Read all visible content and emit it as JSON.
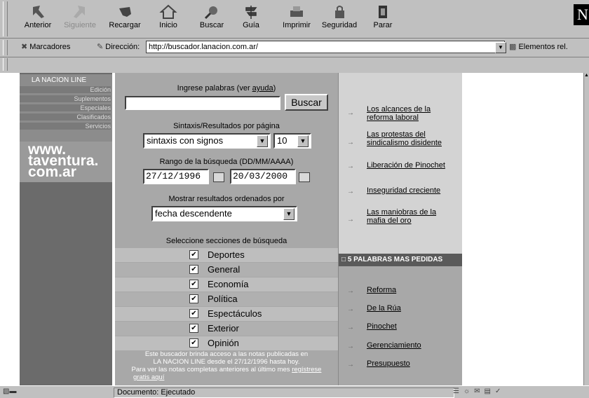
{
  "toolbar": {
    "buttons": [
      {
        "label": "Anterior",
        "icon": "back-arrow-icon",
        "enabled": true
      },
      {
        "label": "Siguiente",
        "icon": "forward-arrow-icon",
        "enabled": false
      },
      {
        "label": "Recargar",
        "icon": "reload-icon",
        "enabled": true
      },
      {
        "label": "Inicio",
        "icon": "home-icon",
        "enabled": true
      },
      {
        "label": "Buscar",
        "icon": "search-icon",
        "enabled": true
      },
      {
        "label": "Guía",
        "icon": "guide-icon",
        "enabled": true
      },
      {
        "label": "Imprimir",
        "icon": "print-icon",
        "enabled": true
      },
      {
        "label": "Seguridad",
        "icon": "lock-icon",
        "enabled": true
      },
      {
        "label": "Parar",
        "icon": "stop-icon",
        "enabled": true
      }
    ],
    "logo": "N"
  },
  "addressbar": {
    "bookmarks_label": "Marcadores",
    "address_label": "Dirección:",
    "url": "http://buscador.lanacion.com.ar/",
    "related_label": "Elementos rel."
  },
  "sidebar": {
    "title": "LA NACION LINE",
    "items": [
      "Edición",
      "Suplementos",
      "Especiales",
      "Clasificados",
      "Servicios"
    ],
    "promo_lines": [
      "www.",
      "taventura.",
      "com.ar"
    ]
  },
  "search": {
    "prompt": "Ingrese palabras (ver ",
    "help_link": "ayuda",
    "prompt_end": ")",
    "query": "",
    "button": "Buscar",
    "syntax_label": "Sintaxis/Resultados por página",
    "syntax_value": "sintaxis con signos",
    "per_page_value": "10",
    "range_label": "Rango de la búsqueda (DD/MM/AAAA)",
    "date_from": "27/12/1996",
    "date_to": "20/03/2000",
    "order_label": "Mostrar resultados ordenados por",
    "order_value": "fecha descendente",
    "sections_label": "Seleccione secciones de búsqueda",
    "sections": [
      {
        "label": "Deportes",
        "checked": true
      },
      {
        "label": "General",
        "checked": true
      },
      {
        "label": "Economía",
        "checked": true
      },
      {
        "label": "Política",
        "checked": true
      },
      {
        "label": "Espectáculos",
        "checked": true
      },
      {
        "label": "Exterior",
        "checked": true
      },
      {
        "label": "Opinión",
        "checked": true
      }
    ],
    "note_line1": "Este buscador brinda acceso a las notas publicadas en",
    "note_line2": "LA NACION LINE desde el 27/12/1996 hasta hoy.",
    "note_line3": "Para ver las notas completas anteriores al último mes ",
    "note_link": "regístrese",
    "note_link2": "gratis aquí"
  },
  "news": [
    {
      "line1": "Los alcances de la",
      "line2": "reforma laboral"
    },
    {
      "line1": "Las protestas del",
      "line2": "sindicalismo disidente"
    },
    {
      "line1": "Liberación de Pinochet",
      "line2": ""
    },
    {
      "line1": "Inseguridad creciente",
      "line2": ""
    },
    {
      "line1": "Las maniobras de la",
      "line2": "mafia del oro"
    }
  ],
  "words": {
    "heading": "5 PALABRAS MAS PEDIDAS",
    "items": [
      "Reforma",
      "De la Rúa",
      "Pinochet",
      "Gerenciamiento",
      "Presupuesto"
    ]
  },
  "status": {
    "text": "Documento: Ejecutado"
  }
}
